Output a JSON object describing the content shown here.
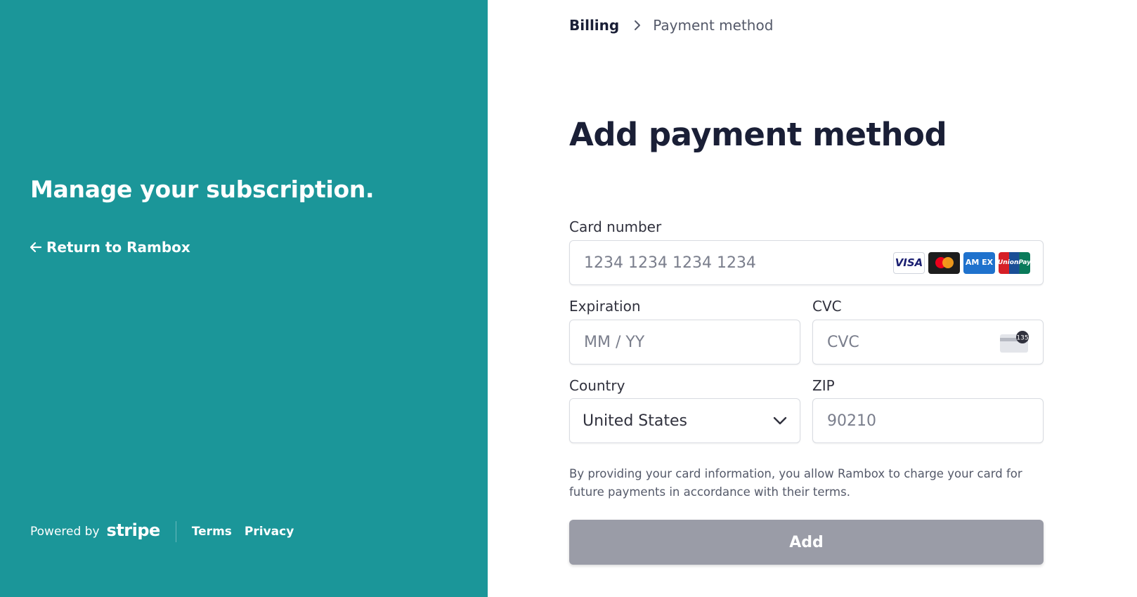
{
  "sidebar": {
    "headline": "Manage your subscription.",
    "back_link": "Return to Rambox",
    "powered_by": "Powered by",
    "stripe_logo": "stripe",
    "terms": "Terms",
    "privacy": "Privacy",
    "background_color": "#1b9699"
  },
  "breadcrumb": {
    "billing": "Billing",
    "current": "Payment method"
  },
  "form": {
    "title": "Add payment method",
    "card_number": {
      "label": "Card number",
      "placeholder": "1234 1234 1234 1234",
      "brands": [
        "visa-icon",
        "mastercard-icon",
        "amex-icon",
        "unionpay-icon"
      ],
      "visa_text": "VISA",
      "amex_text": "AM EX",
      "unionpay_text": "UnionPay"
    },
    "expiration": {
      "label": "Expiration",
      "placeholder": "MM / YY"
    },
    "cvc": {
      "label": "CVC",
      "placeholder": "CVC",
      "icon_text": "135"
    },
    "country": {
      "label": "Country",
      "value": "United States"
    },
    "zip": {
      "label": "ZIP",
      "placeholder": "90210"
    },
    "note": "By providing your card information, you allow Rambox to charge your card for future payments in accordance with their terms.",
    "submit_label": "Add",
    "submit_color": "#9a9ca7"
  }
}
